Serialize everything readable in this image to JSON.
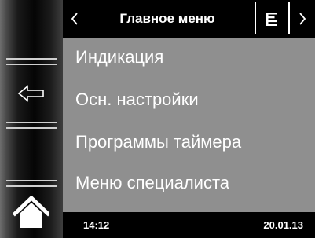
{
  "header": {
    "title": "Главное меню",
    "back_icon": "chevron-left-icon",
    "list_icon": "list-icon",
    "forward_icon": "chevron-right-icon"
  },
  "sidebar": {
    "back_icon": "arrow-left-icon",
    "home_icon": "home-icon"
  },
  "menu": {
    "items": [
      {
        "label": "Индикация"
      },
      {
        "label": "Осн. настройки"
      },
      {
        "label": "Программы таймера"
      },
      {
        "label": "Меню специалиста"
      }
    ]
  },
  "footer": {
    "time": "14:12",
    "date": "20.01.13"
  },
  "colors": {
    "panel": "#8f8f8f",
    "bar": "#000000",
    "text": "#ffffff"
  }
}
